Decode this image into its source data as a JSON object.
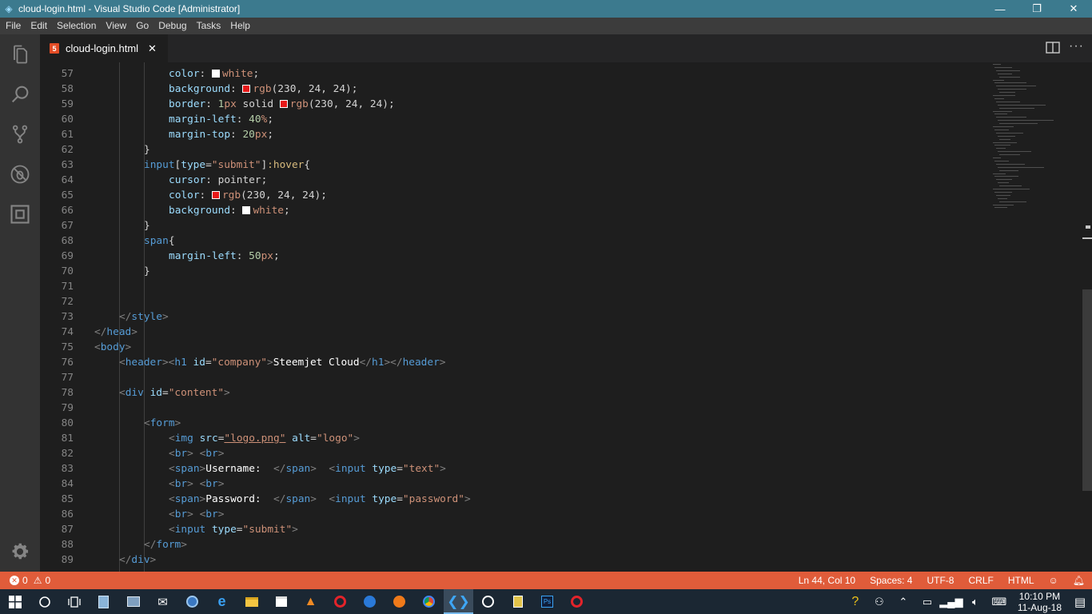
{
  "window": {
    "title": "cloud-login.html - Visual Studio Code [Administrator]",
    "controls": {
      "minimize": "—",
      "restore": "❐",
      "close": "✕"
    }
  },
  "menu": [
    "File",
    "Edit",
    "Selection",
    "View",
    "Go",
    "Debug",
    "Tasks",
    "Help"
  ],
  "activity_bar": [
    "files-icon",
    "search-icon",
    "source-control-icon",
    "debug-icon",
    "extensions-icon",
    "gear-icon"
  ],
  "tab": {
    "badge": "5",
    "label": "cloud-login.html",
    "close": "✕",
    "more": "···"
  },
  "code_lines": [
    {
      "n": "57",
      "indent": 3,
      "tokens": [
        [
          "prop",
          "color"
        ],
        [
          "text",
          ": "
        ],
        [
          "swatch",
          "#ffffff"
        ],
        [
          "val",
          "white"
        ],
        [
          "text",
          ";"
        ]
      ]
    },
    {
      "n": "58",
      "indent": 3,
      "tokens": [
        [
          "prop",
          "background"
        ],
        [
          "text",
          ": "
        ],
        [
          "swatch",
          "#e61818"
        ],
        [
          "val",
          "rgb"
        ],
        [
          "text",
          "(230, 24, 24);"
        ]
      ]
    },
    {
      "n": "59",
      "indent": 3,
      "tokens": [
        [
          "prop",
          "border"
        ],
        [
          "text",
          ": "
        ],
        [
          "num",
          "1"
        ],
        [
          "val",
          "px"
        ],
        [
          "text",
          " solid "
        ],
        [
          "swatch",
          "#e61818"
        ],
        [
          "val",
          "rgb"
        ],
        [
          "text",
          "(230, 24, 24);"
        ]
      ]
    },
    {
      "n": "60",
      "indent": 3,
      "tokens": [
        [
          "prop",
          "margin-left"
        ],
        [
          "text",
          ": "
        ],
        [
          "num",
          "40"
        ],
        [
          "val",
          "%"
        ],
        [
          "text",
          ";"
        ]
      ]
    },
    {
      "n": "61",
      "indent": 3,
      "tokens": [
        [
          "prop",
          "margin-top"
        ],
        [
          "text",
          ": "
        ],
        [
          "num",
          "20"
        ],
        [
          "val",
          "px"
        ],
        [
          "text",
          ";"
        ]
      ]
    },
    {
      "n": "62",
      "indent": 2,
      "tokens": [
        [
          "text",
          "}"
        ]
      ]
    },
    {
      "n": "63",
      "indent": 2,
      "tokens": [
        [
          "tag",
          "input"
        ],
        [
          "text",
          "["
        ],
        [
          "attr",
          "type"
        ],
        [
          "text",
          "="
        ],
        [
          "str",
          "\"submit\""
        ],
        [
          "text",
          "]"
        ],
        [
          "sel",
          ":hover"
        ],
        [
          "text",
          "{"
        ]
      ]
    },
    {
      "n": "64",
      "indent": 3,
      "tokens": [
        [
          "prop",
          "cursor"
        ],
        [
          "text",
          ": pointer;"
        ]
      ]
    },
    {
      "n": "65",
      "indent": 3,
      "tokens": [
        [
          "prop",
          "color"
        ],
        [
          "text",
          ": "
        ],
        [
          "swatch",
          "#e61818"
        ],
        [
          "val",
          "rgb"
        ],
        [
          "text",
          "(230, 24, 24);"
        ]
      ]
    },
    {
      "n": "66",
      "indent": 3,
      "tokens": [
        [
          "prop",
          "background"
        ],
        [
          "text",
          ": "
        ],
        [
          "swatch",
          "#ffffff"
        ],
        [
          "val",
          "white"
        ],
        [
          "text",
          ";"
        ]
      ]
    },
    {
      "n": "67",
      "indent": 2,
      "tokens": [
        [
          "text",
          "}"
        ]
      ]
    },
    {
      "n": "68",
      "indent": 2,
      "tokens": [
        [
          "tag",
          "span"
        ],
        [
          "text",
          "{"
        ]
      ]
    },
    {
      "n": "69",
      "indent": 3,
      "tokens": [
        [
          "prop",
          "margin-left"
        ],
        [
          "text",
          ": "
        ],
        [
          "num",
          "50"
        ],
        [
          "val",
          "px"
        ],
        [
          "text",
          ";"
        ]
      ]
    },
    {
      "n": "70",
      "indent": 2,
      "tokens": [
        [
          "text",
          "}"
        ]
      ]
    },
    {
      "n": "71",
      "indent": 0,
      "tokens": []
    },
    {
      "n": "72",
      "indent": 0,
      "tokens": []
    },
    {
      "n": "73",
      "indent": 1,
      "tokens": [
        [
          "punc",
          "</"
        ],
        [
          "tag",
          "style"
        ],
        [
          "punc",
          ">"
        ]
      ]
    },
    {
      "n": "74",
      "indent": 0,
      "tokens": [
        [
          "punc",
          "</"
        ],
        [
          "tag",
          "head"
        ],
        [
          "punc",
          ">"
        ]
      ]
    },
    {
      "n": "75",
      "indent": 0,
      "tokens": [
        [
          "punc",
          "<"
        ],
        [
          "tag",
          "body"
        ],
        [
          "punc",
          ">"
        ]
      ]
    },
    {
      "n": "76",
      "indent": 1,
      "tokens": [
        [
          "punc",
          "<"
        ],
        [
          "tag",
          "header"
        ],
        [
          "punc",
          "><"
        ],
        [
          "tag",
          "h1"
        ],
        [
          "text",
          " "
        ],
        [
          "attr",
          "id"
        ],
        [
          "text",
          "="
        ],
        [
          "str",
          "\"company\""
        ],
        [
          "punc",
          ">"
        ],
        [
          "white",
          "Steemjet Cloud"
        ],
        [
          "punc",
          "</"
        ],
        [
          "tag",
          "h1"
        ],
        [
          "punc",
          "></"
        ],
        [
          "tag",
          "header"
        ],
        [
          "punc",
          ">"
        ]
      ]
    },
    {
      "n": "77",
      "indent": 0,
      "tokens": []
    },
    {
      "n": "78",
      "indent": 1,
      "tokens": [
        [
          "punc",
          "<"
        ],
        [
          "tag",
          "div"
        ],
        [
          "text",
          " "
        ],
        [
          "attr",
          "id"
        ],
        [
          "text",
          "="
        ],
        [
          "str",
          "\"content\""
        ],
        [
          "punc",
          ">"
        ]
      ]
    },
    {
      "n": "79",
      "indent": 0,
      "tokens": []
    },
    {
      "n": "80",
      "indent": 2,
      "tokens": [
        [
          "punc",
          "<"
        ],
        [
          "tag",
          "form"
        ],
        [
          "punc",
          ">"
        ]
      ]
    },
    {
      "n": "81",
      "indent": 3,
      "tokens": [
        [
          "punc",
          "<"
        ],
        [
          "tag",
          "img"
        ],
        [
          "text",
          " "
        ],
        [
          "attr",
          "src"
        ],
        [
          "text",
          "="
        ],
        [
          "str",
          "\"logo.png\""
        ],
        [
          "text",
          " "
        ],
        [
          "attr",
          "alt"
        ],
        [
          "text",
          "="
        ],
        [
          "str",
          "\"logo\""
        ],
        [
          "punc",
          ">"
        ]
      ]
    },
    {
      "n": "82",
      "indent": 3,
      "tokens": [
        [
          "punc",
          "<"
        ],
        [
          "tag",
          "br"
        ],
        [
          "punc",
          ">"
        ],
        [
          "text",
          " "
        ],
        [
          "punc",
          "<"
        ],
        [
          "tag",
          "br"
        ],
        [
          "punc",
          ">"
        ]
      ]
    },
    {
      "n": "83",
      "indent": 3,
      "tokens": [
        [
          "punc",
          "<"
        ],
        [
          "tag",
          "span"
        ],
        [
          "punc",
          ">"
        ],
        [
          "white",
          "Username:  "
        ],
        [
          "punc",
          "</"
        ],
        [
          "tag",
          "span"
        ],
        [
          "punc",
          ">"
        ],
        [
          "text",
          "  "
        ],
        [
          "punc",
          "<"
        ],
        [
          "tag",
          "input"
        ],
        [
          "text",
          " "
        ],
        [
          "attr",
          "type"
        ],
        [
          "text",
          "="
        ],
        [
          "str",
          "\"text\""
        ],
        [
          "punc",
          ">"
        ]
      ]
    },
    {
      "n": "84",
      "indent": 3,
      "tokens": [
        [
          "punc",
          "<"
        ],
        [
          "tag",
          "br"
        ],
        [
          "punc",
          ">"
        ],
        [
          "text",
          " "
        ],
        [
          "punc",
          "<"
        ],
        [
          "tag",
          "br"
        ],
        [
          "punc",
          ">"
        ]
      ]
    },
    {
      "n": "85",
      "indent": 3,
      "tokens": [
        [
          "punc",
          "<"
        ],
        [
          "tag",
          "span"
        ],
        [
          "punc",
          ">"
        ],
        [
          "white",
          "Password:  "
        ],
        [
          "punc",
          "</"
        ],
        [
          "tag",
          "span"
        ],
        [
          "punc",
          ">"
        ],
        [
          "text",
          "  "
        ],
        [
          "punc",
          "<"
        ],
        [
          "tag",
          "input"
        ],
        [
          "text",
          " "
        ],
        [
          "attr",
          "type"
        ],
        [
          "text",
          "="
        ],
        [
          "str",
          "\"password\""
        ],
        [
          "punc",
          ">"
        ]
      ]
    },
    {
      "n": "86",
      "indent": 3,
      "tokens": [
        [
          "punc",
          "<"
        ],
        [
          "tag",
          "br"
        ],
        [
          "punc",
          ">"
        ],
        [
          "text",
          " "
        ],
        [
          "punc",
          "<"
        ],
        [
          "tag",
          "br"
        ],
        [
          "punc",
          ">"
        ]
      ]
    },
    {
      "n": "87",
      "indent": 3,
      "tokens": [
        [
          "punc",
          "<"
        ],
        [
          "tag",
          "input"
        ],
        [
          "text",
          " "
        ],
        [
          "attr",
          "type"
        ],
        [
          "text",
          "="
        ],
        [
          "str",
          "\"submit\""
        ],
        [
          "punc",
          ">"
        ]
      ]
    },
    {
      "n": "88",
      "indent": 2,
      "tokens": [
        [
          "punc",
          "</"
        ],
        [
          "tag",
          "form"
        ],
        [
          "punc",
          ">"
        ]
      ]
    },
    {
      "n": "89",
      "indent": 1,
      "tokens": [
        [
          "punc",
          "</"
        ],
        [
          "tag",
          "div"
        ],
        [
          "punc",
          ">"
        ]
      ]
    }
  ],
  "status": {
    "errors": "0",
    "warnings": "0",
    "position": "Ln 44, Col 10",
    "spaces": "Spaces: 4",
    "encoding": "UTF-8",
    "eol": "CRLF",
    "language": "HTML"
  },
  "taskbar": {
    "apps": [
      "start-icon",
      "cortana-icon",
      "task-view-icon",
      "notepad-icon",
      "photos-icon",
      "mail-icon",
      "network-icon",
      "edge-icon",
      "explorer-icon",
      "store-icon",
      "vlc-icon",
      "opera-icon",
      "firefox-dev-icon",
      "firefox-icon",
      "chrome-icon",
      "vscode-icon",
      "obs-icon",
      "game-icon",
      "photoshop-icon",
      "opera-red-icon"
    ],
    "time": "10:10 PM",
    "date": "11-Aug-18"
  },
  "colors": {
    "titlebar": "#3c7a8e",
    "statusbar": "#e05c3a",
    "activity": "#333333",
    "editor": "#1e1e1e"
  }
}
